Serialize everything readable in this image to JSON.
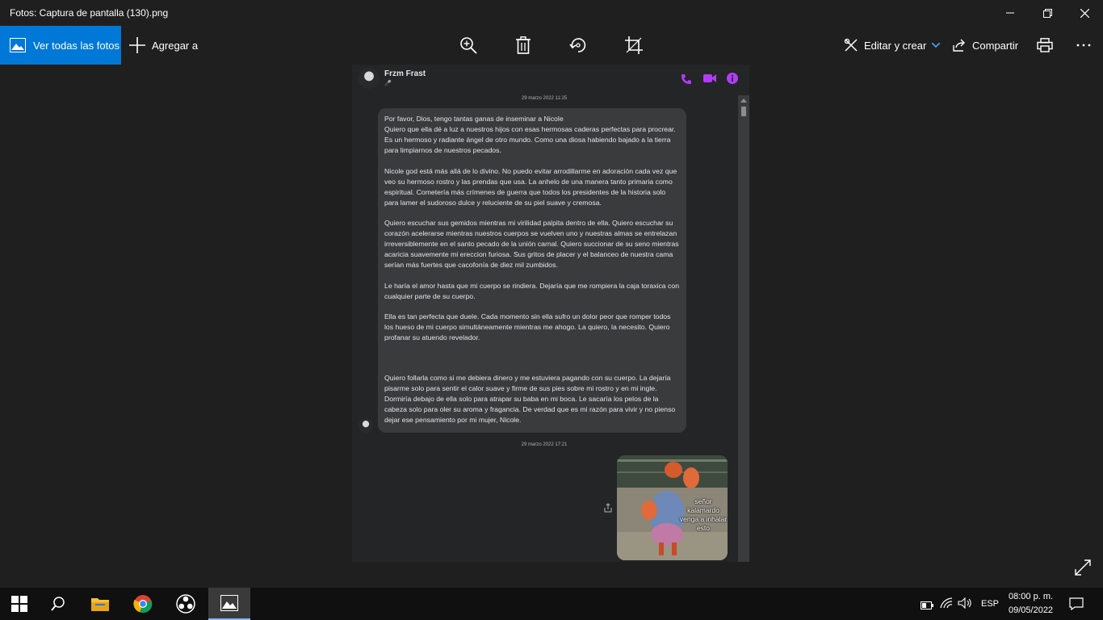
{
  "window": {
    "title": "Fotos: Captura de pantalla (130).png"
  },
  "toolbar": {
    "see_all_label": "Ver todas las fotos",
    "add_label": "Agregar a",
    "edit_label": "Editar y crear",
    "share_label": "Compartir"
  },
  "chat": {
    "contact_name": "Frzm Frast",
    "contact_status": "🎤",
    "timestamp_1": "29 marzo 2022 11:25",
    "message_paragraphs": [
      "Por favor, Dios, tengo tantas ganas de inseminar a Nicole\nQuiero que ella dé a luz a nuestros hijos con esas hermosas caderas perfectas para procrear. Es un hermoso y radiante ángel de otro mundo. Como una diosa habiendo bajado a la tierra para limpiarnos de nuestros pecados.",
      "Nicole god está más allá de lo divino. No puedo evitar arrodillarme en adoración cada vez que veo su hermoso rostro y las prendas que usa. La anhelo de una manera tanto primaria como espiritual. Cometería más crímenes de guerra que todos los presidentes de la historia solo para lamer el sudoroso dulce y reluciente de su piel suave y cremosa.",
      "Quiero escuchar sus gemidos mientras mi virilidad palpita dentro de ella. Quiero escuchar su corazón acelerarse mientras nuestros cuerpos se vuelven uno y nuestras almas se entrelazan irreversiblemente en el santo pecado de la unión carnal. Quiero succionar de su seno mientras acaricia suavemente mi ereccion furiosa. Sus gritos de placer y el balanceo de nuestra cama serían más fuertes que cacofonía de diez mil zumbidos.",
      "Le haría el amor hasta que mi cuerpo se rindiera. Dejaría que me rompiera la caja toraxica con cualquier parte de su cuerpo.",
      "Ella es tan perfecta que duele. Cada momento sin ella sufro un dolor peor que romper todos los hueso de mi cuerpo simultáneamente mientras me ahogo. La quiero, la necesito. Quiero profanar su atuendo revelador."
    ],
    "message_2": "Quiero follarla como si me debiera dinero y me estuviera pagando con su cuerpo. La dejaría pisarme solo para sentir el calor suave y firme de sus pies sobre mi rostro y en mi ingle. Dormiría debajo de ella solo para atrapar su baba en mi boca. Le sacaría los pelos de la cabeza solo para oler su aroma y fragancia. De verdad que es mi razón para vivir y no pienso dejar ese pensamiento por mi mujer, Nicole.",
    "timestamp_2": "29 marzo 2022 17:21",
    "meme_caption": "señor\nkalamardo\nvenga a inhalar\nesto"
  },
  "tray": {
    "language": "ESP",
    "time": "08:00 p. m.",
    "date": "09/05/2022"
  },
  "colors": {
    "accent": "#0078d7",
    "messenger_icon": "#b23cf6",
    "bubble": "#3a3b3c",
    "chat_bg": "#242526"
  }
}
